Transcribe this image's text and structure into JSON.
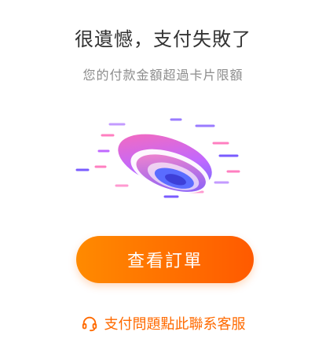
{
  "header": {
    "title": "很遺憾，支付失敗了",
    "subtitle": "您的付款金額超過卡片限額"
  },
  "actions": {
    "view_order_label": "查看訂單"
  },
  "support": {
    "label": "支付問題點此聯系客服",
    "icon": "headset-icon"
  },
  "colors": {
    "accent": "#ff6a00",
    "button_start": "#ff8a00",
    "button_end": "#ff5a00",
    "illustration_pink": "#f05aa8",
    "illustration_purple": "#7a5cff",
    "illustration_blue": "#5a6cff"
  }
}
